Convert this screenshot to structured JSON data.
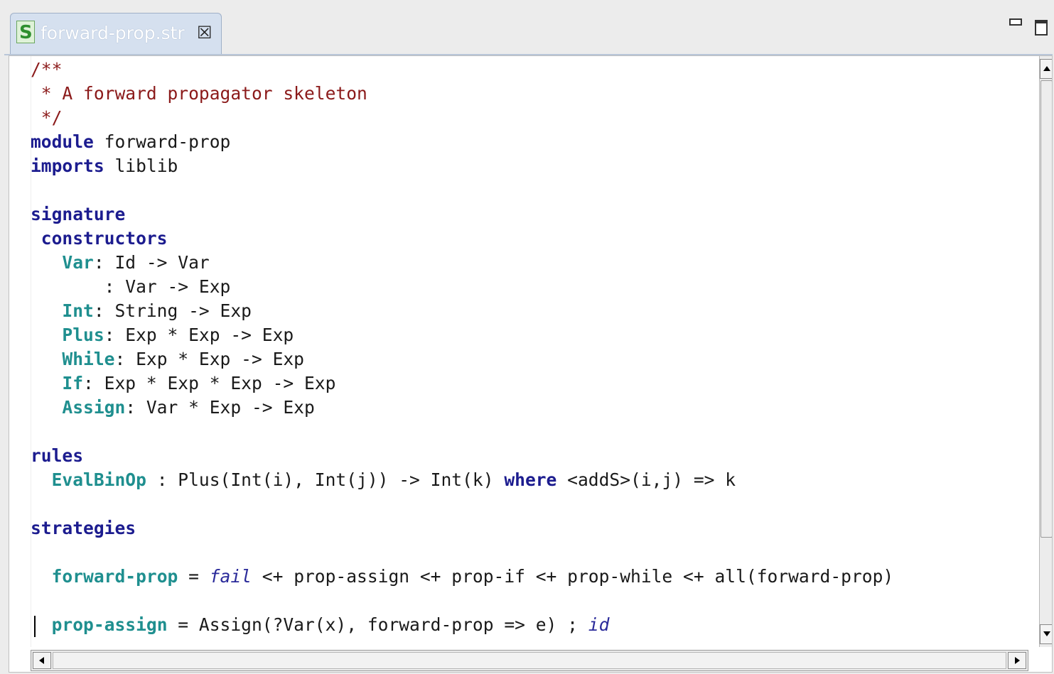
{
  "tab": {
    "title": "forward-prop.str",
    "file_icon_letter": "S",
    "close_icon": "close-icon"
  },
  "window_controls": {
    "minimize_icon": "minimize-icon",
    "maximize_icon": "maximize-icon"
  },
  "colors": {
    "keyword": "#1c1c8f",
    "constructor": "#1f8f8f",
    "comment": "#8b1a1a",
    "tab_background": "#d5e0ef"
  },
  "code": {
    "l1": "/**",
    "l2": " * A forward propagator skeleton",
    "l3": " */",
    "kw_module": "module",
    "l4_rest": " forward-prop",
    "kw_imports": "imports",
    "l5_rest": " liblib",
    "kw_signature": "signature",
    "kw_constructors": " constructors",
    "c_var": "Var",
    "l8_rest": ": Id -> Var",
    "l9": "       : Var -> Exp",
    "c_int": "Int",
    "l10_rest": ": String -> Exp",
    "c_plus": "Plus",
    "l11_rest": ": Exp * Exp -> Exp",
    "c_while": "While",
    "l12_rest": ": Exp * Exp -> Exp",
    "c_if": "If",
    "l13_rest": ": Exp * Exp * Exp -> Exp",
    "c_assign": "Assign",
    "l14_rest": ": Var * Exp -> Exp",
    "kw_rules": "rules",
    "c_evalbinop": "EvalBinOp",
    "l17_mid": " : Plus(Int(i), Int(j)) -> Int(k) ",
    "kw_where": "where",
    "l17_rest": " <addS>(i,j) => k",
    "kw_strategies": "strategies",
    "c_forward_prop": "forward-prop",
    "l21_eq": " = ",
    "it_fail": "fail",
    "l21_rest": " <+ prop-assign <+ prop-if <+ prop-while <+ all(forward-prop)",
    "c_prop_assign": "prop-assign",
    "l23_mid": " = Assign(?Var(x), forward-prop => e) ; ",
    "it_id": "id"
  }
}
